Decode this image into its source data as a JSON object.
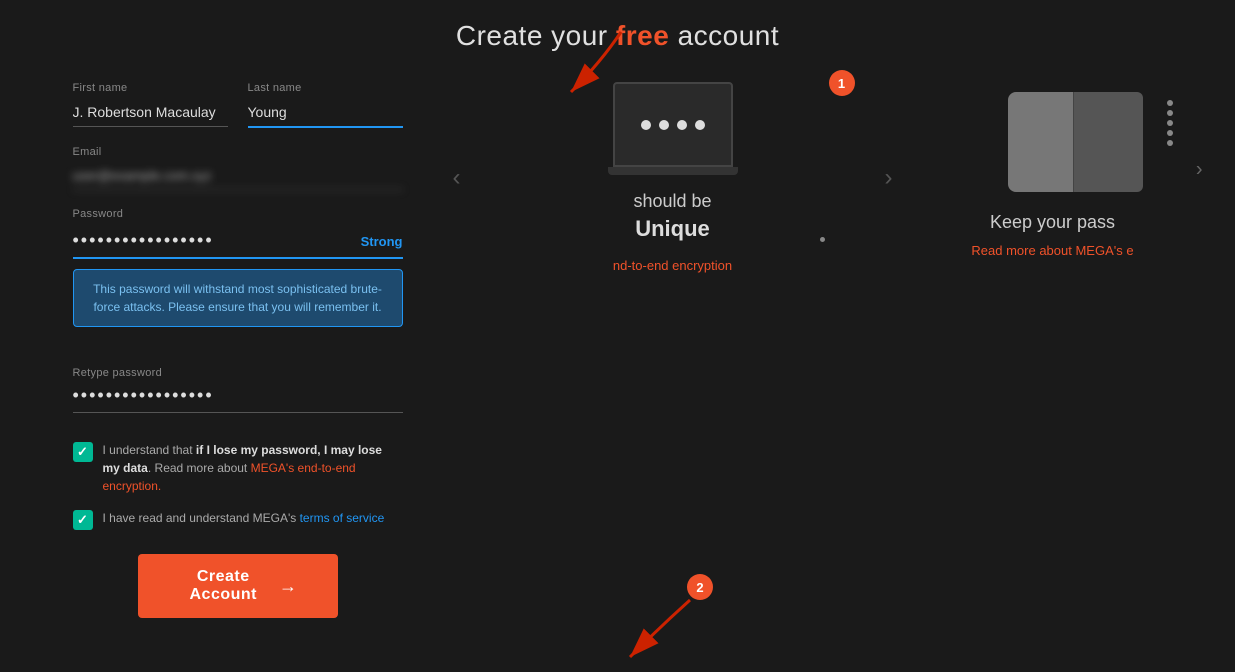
{
  "page": {
    "title_pre": "Create your ",
    "title_highlight": "free",
    "title_post": " account"
  },
  "form": {
    "first_name_label": "First name",
    "first_name_value": "J. Robertson Macaulay",
    "last_name_label": "Last name",
    "last_name_value": "Young",
    "email_label": "Email",
    "email_placeholder": "••••••••••••••••••",
    "password_label": "Password",
    "password_dots": "••••••••••••••",
    "strength_label": "Strong",
    "password_tip": "This password will withstand most sophisticated brute-force attacks. Please ensure that you will remember it.",
    "retype_label": "Retype password",
    "retype_dots": "••••••••••••",
    "checkbox1_text_pre": "I understand that ",
    "checkbox1_bold": "if I lose my password, I may lose my data",
    "checkbox1_text_mid": ". Read more about ",
    "checkbox1_link": "MEGA's end-to-end encryption.",
    "checkbox2_text_pre": "I have read and understand MEGA's ",
    "checkbox2_link": "terms of service",
    "create_btn_label": "Create Account",
    "create_btn_arrow": "→"
  },
  "carousel": {
    "slide1_subtitle": "should be",
    "slide1_main": "Unique",
    "slide1_link": "nd-to-end encryption",
    "badge1": "1",
    "badge2": "2"
  },
  "right_panel": {
    "title": "Keep your pass",
    "link": "Read more about MEGA's e"
  },
  "password_display": {
    "dots": [
      "*",
      "*",
      "*",
      "*"
    ]
  }
}
